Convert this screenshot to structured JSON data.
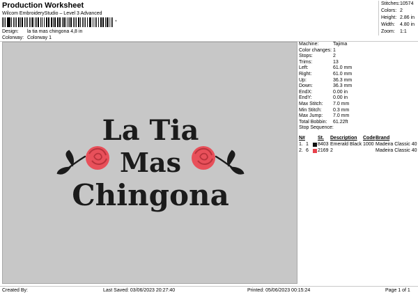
{
  "header": {
    "title": "Production Worksheet",
    "software": "Wilcom EmbroideryStudio – Level 3 Advanced",
    "barcode_tail": ","
  },
  "meta": {
    "design_label": "Design:",
    "design_value": "la tia mas chingona 4,8 in",
    "colorway_label": "Colorway:",
    "colorway_value": "Colorway 1"
  },
  "summary": [
    {
      "k": "Stitches:",
      "v": "10574"
    },
    {
      "k": "Colors:",
      "v": "2"
    },
    {
      "k": "Height:",
      "v": "2.86 in"
    },
    {
      "k": "Width:",
      "v": "4.80 in"
    },
    {
      "k": "Zoom:",
      "v": "1:1"
    }
  ],
  "params": [
    {
      "k": "Machine:",
      "v": "Tajima"
    },
    {
      "k": "Color changes:",
      "v": "1"
    },
    {
      "k": "Stops:",
      "v": "2"
    },
    {
      "k": "Trims:",
      "v": "13"
    },
    {
      "k": "Left:",
      "v": "61.0 mm"
    },
    {
      "k": "Right:",
      "v": "61.0 mm"
    },
    {
      "k": "Up:",
      "v": "36.3 mm"
    },
    {
      "k": "Down:",
      "v": "36.3 mm"
    },
    {
      "k": "EndX:",
      "v": "0.00 in"
    },
    {
      "k": "EndY:",
      "v": "0.00 in"
    },
    {
      "k": "Max Stitch:",
      "v": "7.0 mm"
    },
    {
      "k": "Min Stitch:",
      "v": "0.3 mm"
    },
    {
      "k": "Max Jump:",
      "v": "7.0 mm"
    },
    {
      "k": "Total Bobbin:",
      "v": "61.22ft"
    },
    {
      "k": "Stop Sequence:",
      "v": ""
    }
  ],
  "sequence": {
    "headers": [
      "N#",
      "St.",
      "Description",
      "Code",
      "Brand"
    ],
    "rows": [
      {
        "num": "1.",
        "sub": "1",
        "color": "#111111",
        "code_num": "8403",
        "st": "Emerald Black",
        "code": "1000",
        "brand": "Madeira Classic 40"
      },
      {
        "num": "2.",
        "sub": "6",
        "color": "#e8414b",
        "code_num": "2169",
        "st": "2",
        "code": "",
        "brand": "Madeira Classic 40"
      }
    ]
  },
  "design": {
    "line1": "La Tia",
    "line2": "Mas",
    "line3": "Chingona",
    "text_color": "#1b1b1b",
    "rose_color": "#e8505a",
    "rose_dark": "#b8333c",
    "canvas_color": "#c7c7c7"
  },
  "footer": {
    "created_by": "Created By:",
    "last_saved": "Last Saved: 03/06/2023 20:27:40",
    "printed": "Printed: 05/06/2023 00:15:24",
    "page": "Page 1 of 1"
  }
}
